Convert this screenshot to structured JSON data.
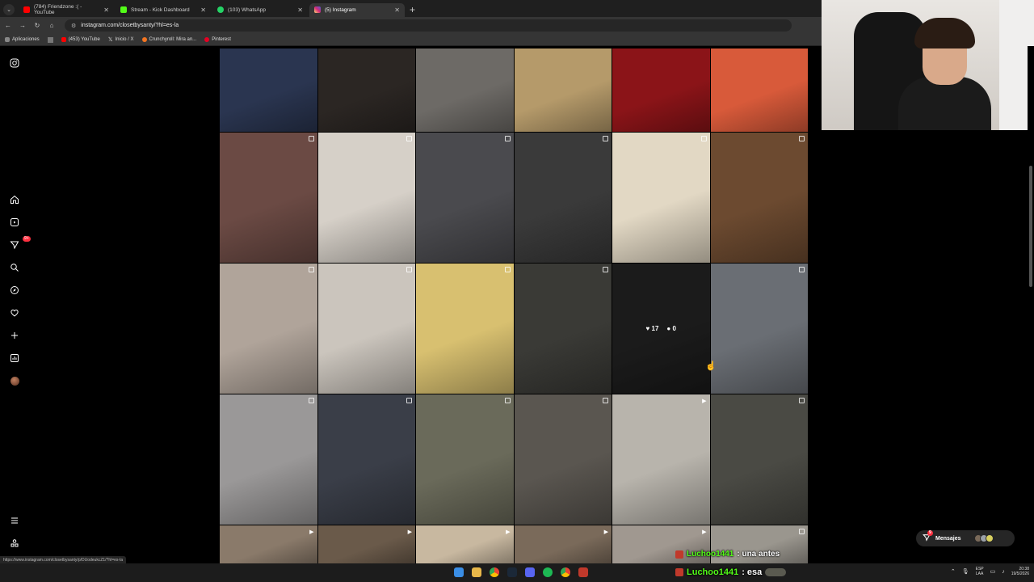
{
  "browser": {
    "tabs": [
      {
        "title": "(784) Friendzone :( - YouTube",
        "fav_color": "#ff0000",
        "active": false
      },
      {
        "title": "Stream - Kick Dashboard",
        "fav_color": "#53fc18",
        "active": false
      },
      {
        "title": "(103) WhatsApp",
        "fav_color": "#25d366",
        "active": false
      },
      {
        "title": "(5) Instagram",
        "fav_color": "#d62976",
        "active": true
      }
    ],
    "url": "instagram.com/closetbysanty/?hl=es-la",
    "bookmarks": [
      {
        "label": "Aplicaciones",
        "color": "#888888"
      },
      {
        "label": "(453) YouTube",
        "color": "#ff0000"
      },
      {
        "label": "Inicio / X",
        "color": "#ffffff"
      },
      {
        "label": "Crunchyroll: Mira an...",
        "color": "#f47521"
      },
      {
        "label": "Pinterest",
        "color": "#e60023"
      }
    ]
  },
  "sidebar": {
    "notifications_badge": "9+"
  },
  "grid": {
    "hover": {
      "likes": "17",
      "comments": "0"
    },
    "rows": [
      [
        "#2a3550",
        "#2b2623",
        "#6d6a66",
        "#b59a6a",
        "#8b1418",
        "#d85a3a"
      ],
      [
        "#6b4a44",
        "#d6d0c8",
        "#4a4a4e",
        "#3a3a3a",
        "#e2d8c4",
        "#6c4a30"
      ],
      [
        "#b0a49a",
        "#cbc5bd",
        "#d8c070",
        "#3a3a36",
        "#2a2a2a",
        "#6a6e74"
      ],
      [
        "#9a9898",
        "#3a3e48",
        "#6a6a5a",
        "#5a5650",
        "#b8b4ac",
        "#4a4a44"
      ],
      [
        "#8a7a6a",
        "#6a5a4a",
        "#c8b8a0",
        "#7a6a5a",
        "#a09890",
        "#9a968e"
      ]
    ],
    "badges": [
      [
        "none",
        "none",
        "none",
        "none",
        "none",
        "none"
      ],
      [
        "multi",
        "multi",
        "multi",
        "multi",
        "multi",
        "multi"
      ],
      [
        "multi",
        "multi",
        "multi",
        "multi",
        "none",
        "multi"
      ],
      [
        "multi",
        "multi",
        "multi",
        "multi",
        "reel",
        "multi"
      ],
      [
        "reel",
        "reel",
        "reel",
        "reel",
        "reel",
        "multi"
      ]
    ]
  },
  "status_link": "https://www.instagram.com/closetbysanty/p/DUodeukcZ1/?hl=es-la",
  "messages": {
    "label": "Mensajes",
    "badge": "9"
  },
  "chat": [
    {
      "user": "Luchoo1441",
      "text": ": una antes"
    },
    {
      "user": "Luchoo1441",
      "text": ": esa"
    }
  ],
  "tray": {
    "lang": "ESP",
    "layout": "LAA",
    "time": "20:38",
    "date": "19/5/2026"
  }
}
